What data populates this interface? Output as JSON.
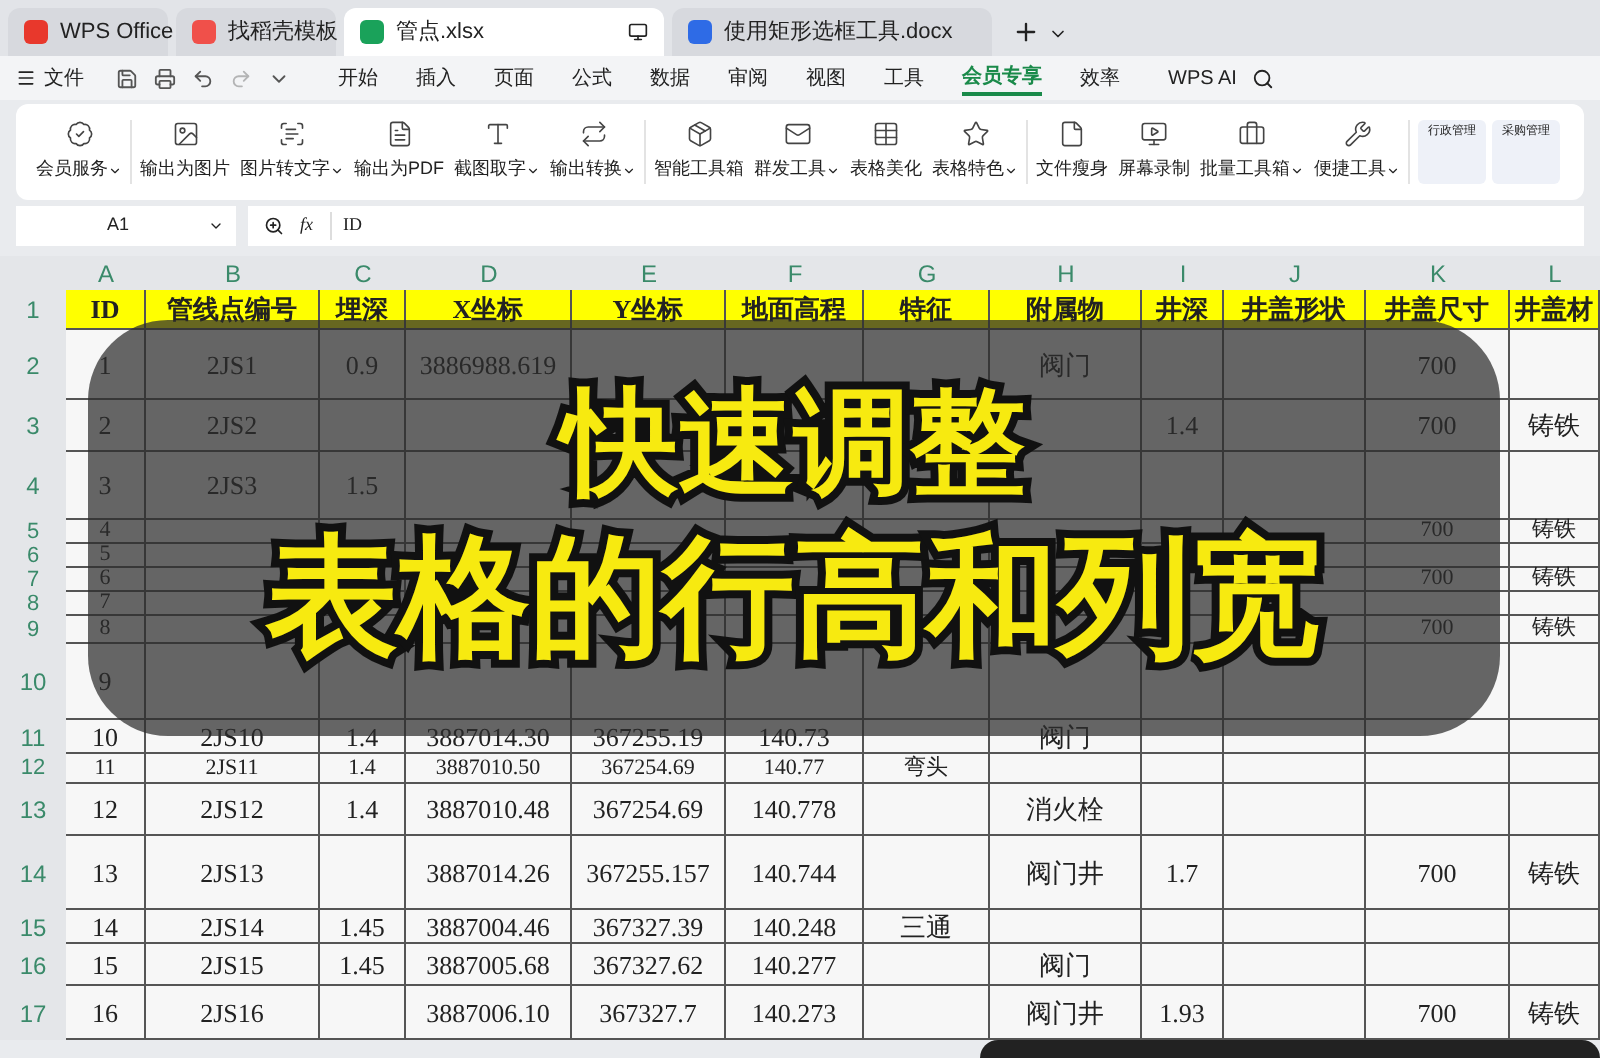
{
  "tabs": [
    {
      "kind": "wps",
      "label": "WPS Office",
      "selected": false
    },
    {
      "kind": "docer",
      "label": "找稻壳模板",
      "selected": false
    },
    {
      "kind": "sheet",
      "label": "管点.xlsx",
      "selected": true
    },
    {
      "kind": "doc",
      "label": "使用矩形选框工具.docx",
      "selected": false
    }
  ],
  "menu": {
    "file": "文件",
    "items": [
      {
        "label": "开始",
        "selected": false
      },
      {
        "label": "插入",
        "selected": false
      },
      {
        "label": "页面",
        "selected": false
      },
      {
        "label": "公式",
        "selected": false
      },
      {
        "label": "数据",
        "selected": false
      },
      {
        "label": "审阅",
        "selected": false
      },
      {
        "label": "视图",
        "selected": false
      },
      {
        "label": "工具",
        "selected": false
      },
      {
        "label": "会员专享",
        "selected": true
      },
      {
        "label": "效率",
        "selected": false
      }
    ],
    "ai": "WPS AI"
  },
  "ribbon": {
    "groups": [
      [
        {
          "kind": "badge",
          "label": "会员服务",
          "dropdown": true
        }
      ],
      [
        {
          "kind": "image",
          "label": "输出为图片",
          "dropdown": false
        },
        {
          "kind": "scan",
          "label": "图片转文字",
          "dropdown": true
        },
        {
          "kind": "pdf",
          "label": "输出为PDF",
          "dropdown": false
        },
        {
          "kind": "text",
          "label": "截图取字",
          "dropdown": true
        },
        {
          "kind": "convert",
          "label": "输出转换",
          "dropdown": true
        }
      ],
      [
        {
          "kind": "toolbox",
          "label": "智能工具箱",
          "dropdown": false
        },
        {
          "kind": "mail",
          "label": "群发工具",
          "dropdown": true
        },
        {
          "kind": "table",
          "label": "表格美化",
          "dropdown": false
        },
        {
          "kind": "star",
          "label": "表格特色",
          "dropdown": true
        }
      ],
      [
        {
          "kind": "file",
          "label": "文件瘦身",
          "dropdown": false
        },
        {
          "kind": "record",
          "label": "屏幕录制",
          "dropdown": false
        },
        {
          "kind": "briefcase",
          "label": "批量工具箱",
          "dropdown": true
        },
        {
          "kind": "tools",
          "label": "便捷工具",
          "dropdown": true
        }
      ]
    ],
    "templates": [
      "行政管理",
      "采购管理"
    ]
  },
  "formula_bar": {
    "cell": "A1",
    "fx": "fx",
    "value": "ID"
  },
  "columns": [
    "A",
    "B",
    "C",
    "D",
    "E",
    "F",
    "G",
    "H",
    "I",
    "J",
    "K",
    "L"
  ],
  "rows": [
    {
      "kind": "header",
      "row": "1",
      "cells": {
        "A": "ID",
        "B": "管线点编号",
        "C": "埋深",
        "D": "X坐标",
        "E": "Y坐标",
        "F": "地面高程",
        "G": "特征",
        "H": "附属物",
        "I": "井深",
        "J": "井盖形状",
        "K": "井盖尺寸",
        "L": "井盖材"
      }
    },
    {
      "kind": "data",
      "row": "2",
      "cells": {
        "A": "1",
        "B": "2JS1",
        "C": "0.9",
        "D": "3886988.619",
        "H": "阀门",
        "K": "700"
      }
    },
    {
      "kind": "data",
      "row": "3",
      "cells": {
        "A": "2",
        "B": "2JS2",
        "I": "1.4",
        "K": "700",
        "L": "铸铁"
      }
    },
    {
      "kind": "data",
      "row": "4",
      "cells": {
        "A": "3",
        "B": "2JS3",
        "C": "1.5"
      }
    },
    {
      "kind": "data",
      "row": "5",
      "cells": {
        "A": "4",
        "K": "700",
        "L": "铸铁"
      }
    },
    {
      "kind": "data",
      "row": "6",
      "cells": {
        "A": "5"
      }
    },
    {
      "kind": "data",
      "row": "7",
      "cells": {
        "A": "6",
        "K": "700",
        "L": "铸铁"
      }
    },
    {
      "kind": "data",
      "row": "8",
      "cells": {
        "A": "7"
      }
    },
    {
      "kind": "data",
      "row": "9",
      "cells": {
        "A": "8",
        "K": "700",
        "L": "铸铁"
      }
    },
    {
      "kind": "data",
      "row": "10",
      "cells": {
        "A": "9"
      }
    },
    {
      "kind": "data",
      "row": "11",
      "cells": {
        "A": "10",
        "B": "2JS10",
        "C": "1.4",
        "D": "3887014.30",
        "E": "367255.19",
        "F": "140.73",
        "H": "阀门"
      }
    },
    {
      "kind": "data",
      "row": "12",
      "cells": {
        "A": "11",
        "B": "2JS11",
        "C": "1.4",
        "D": "3887010.50",
        "E": "367254.69",
        "F": "140.77",
        "G": "弯头"
      }
    },
    {
      "kind": "data",
      "row": "13",
      "cells": {
        "A": "12",
        "B": "2JS12",
        "C": "1.4",
        "D": "3887010.48",
        "E": "367254.69",
        "F": "140.778",
        "H": "消火栓"
      }
    },
    {
      "kind": "data",
      "row": "14",
      "cells": {
        "A": "13",
        "B": "2JS13",
        "D": "3887014.26",
        "E": "367255.157",
        "F": "140.744",
        "H": "阀门井",
        "I": "1.7",
        "K": "700",
        "L": "铸铁"
      }
    },
    {
      "kind": "data",
      "row": "15",
      "cells": {
        "A": "14",
        "B": "2JS14",
        "C": "1.45",
        "D": "3887004.46",
        "E": "367327.39",
        "F": "140.248",
        "G": "三通"
      }
    },
    {
      "kind": "data",
      "row": "16",
      "cells": {
        "A": "15",
        "B": "2JS15",
        "C": "1.45",
        "D": "3887005.68",
        "E": "367327.62",
        "F": "140.277",
        "H": "阀门"
      }
    },
    {
      "kind": "data",
      "row": "17",
      "cells": {
        "A": "16",
        "B": "2JS16",
        "D": "3887006.10",
        "E": "367327.7",
        "F": "140.273",
        "H": "阀门井",
        "I": "1.93",
        "K": "700",
        "L": "铸铁"
      }
    }
  ],
  "caption": [
    "快速调整",
    "表格的行高和列宽"
  ]
}
